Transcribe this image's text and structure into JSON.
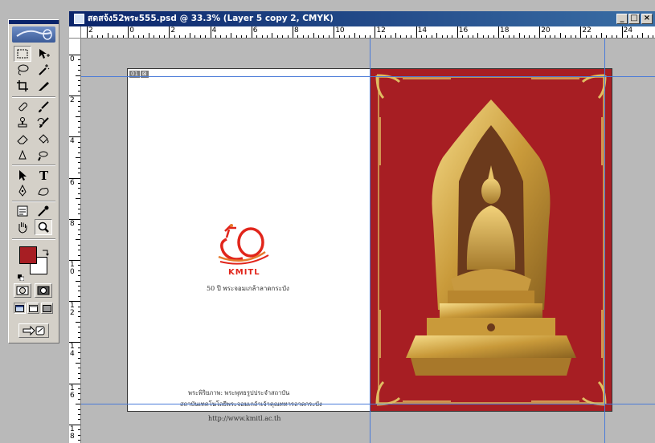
{
  "window": {
    "title": "สดสจ้ง52พระ555.psd @ 33.3% (Layer 5 copy 2, CMYK)",
    "minimize": "_",
    "maximize": "□",
    "close": "×"
  },
  "rulers": {
    "top_labels": [
      "2",
      "0",
      "2",
      "4",
      "6",
      "8",
      "10",
      "12",
      "14",
      "16",
      "18",
      "20",
      "22",
      "24"
    ],
    "left_labels": [
      "0",
      "2",
      "4",
      "6",
      "8",
      "1\n0",
      "1\n2",
      "1\n4",
      "1\n6",
      "1\n8"
    ]
  },
  "tools": {
    "foreground_color": "#a71e23",
    "background_color": "#ffffff",
    "items": [
      "marquee-icon",
      "move-icon",
      "lasso-icon",
      "magic-wand-icon",
      "crop-icon",
      "slice-icon",
      "healing-brush-icon",
      "brush-icon",
      "clone-stamp-icon",
      "history-brush-icon",
      "eraser-icon",
      "paint-bucket-icon",
      "blur-icon",
      "dodge-icon",
      "path-selection-icon",
      "type-icon",
      "pen-icon",
      "custom-shape-icon",
      "notes-icon",
      "eyedropper-icon",
      "hand-icon",
      "zoom-icon"
    ]
  },
  "document": {
    "slice_tag": [
      "01",
      "⊠"
    ],
    "logo_text": "KMITL",
    "subtitle": "50 ปี พระจอมเกล้าลาดกระบัง",
    "credit_line1": "พระพิริยภาพ: พระพุทธรูปประจำสถาบัน",
    "credit_line2": "สถาบันเทคโนโลยีพระจอมเกล้าเจ้าคุณทหารลาดกระบัง",
    "website": "http://www.kmitl.ac.th",
    "right_page_color": "#a71e23"
  }
}
